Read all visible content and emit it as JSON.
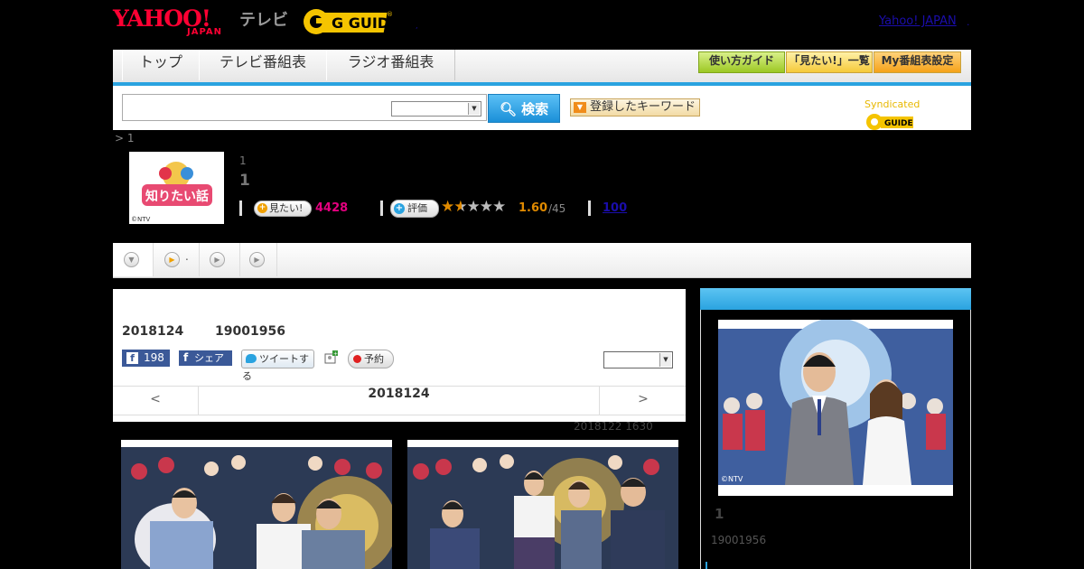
{
  "header": {
    "yahoo_logo_main": "YAHOO!",
    "yahoo_logo_sub": "JAPAN",
    "tv_label": "テレビ",
    "gguide_logo": "G GUIDE",
    "yahoo_japan_link": "Yahoo! JAPAN",
    "link_dot": ".",
    "header_dot": ","
  },
  "nav": {
    "tabs": [
      "トップ",
      "テレビ番組表",
      "ラジオ番組表"
    ],
    "buttons": [
      "使い方ガイド",
      "「見たい!」一覧",
      "My番組表設定"
    ]
  },
  "search": {
    "input_value": "",
    "select_value": "",
    "button_label": "検索",
    "keyword_button": "登録したキーワード",
    "syndicated_label": "Syndicated"
  },
  "breadcrumb": "> 1",
  "program": {
    "thumb_label": "知りたい話",
    "thumb_credit": "©NTV",
    "subtitle": "1",
    "title": "1",
    "want_label": "見たい!",
    "want_count": "4428",
    "rate_label": "評価",
    "rating": 1.6,
    "rating_text": "1.60",
    "rating_max": "/45",
    "review_link": "100"
  },
  "subtabs": [
    {
      "icon": "▼",
      "label": ""
    },
    {
      "icon": "▶",
      "label": "."
    },
    {
      "icon": "▶",
      "label": ""
    },
    {
      "icon": "▶",
      "label": ""
    }
  ],
  "episode": {
    "air_date": "2018124",
    "air_time": "19001956",
    "like_count": "198",
    "share_label": "シェア",
    "tweet_label": "ツイートする",
    "reserve_label": "予約",
    "select_value": "",
    "pager_prev": "<",
    "pager_date": "2018124",
    "pager_next": ">",
    "updated": "2018122  1630"
  },
  "sidebar": {
    "image_credit": "©NTV",
    "title": "1",
    "time": "19001956"
  },
  "colors": {
    "accent_blue": "#2aa3e0",
    "pink": "#e4007f",
    "rating_orange": "#e08a00",
    "facebook": "#3b5998"
  }
}
